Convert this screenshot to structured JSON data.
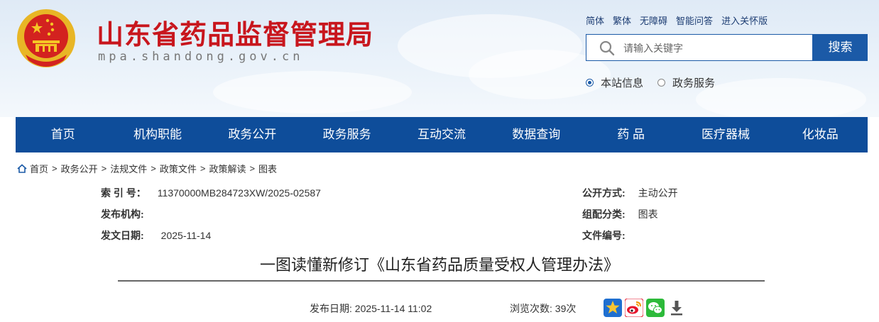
{
  "header": {
    "site_title": "山东省药品监督管理局",
    "site_domain": "mpa.shandong.gov.cn",
    "top_links": [
      "简体",
      "繁体",
      "无障碍",
      "智能问答",
      "进入关怀版"
    ],
    "search": {
      "placeholder": "请输入关键字",
      "button_label": "搜索"
    },
    "scope_options": [
      {
        "label": "本站信息",
        "selected": true
      },
      {
        "label": "政务服务",
        "selected": false
      }
    ]
  },
  "nav": [
    "首页",
    "机构职能",
    "政务公开",
    "政务服务",
    "互动交流",
    "数据查询",
    "药 品",
    "医疗器械",
    "化妆品"
  ],
  "breadcrumb": [
    "首页",
    "政务公开",
    "法规文件",
    "政策文件",
    "政策解读",
    "图表"
  ],
  "meta": {
    "index_label": "索 引 号：",
    "index_value": "11370000MB284723XW/2025-02587",
    "issuer_label": "发布机构:",
    "issuer_value": "",
    "date_label": "发文日期:",
    "date_value": "2025-11-14",
    "disclosure_label": "公开方式:",
    "disclosure_value": "主动公开",
    "category_label": "组配分类:",
    "category_value": "图表",
    "docno_label": "文件编号:",
    "docno_value": ""
  },
  "article": {
    "title": "一图读懂新修订《山东省药品质量受权人管理办法》",
    "publish_text": "发布日期:  2025-11-14 11:02",
    "views_text": "浏览次数:  39次"
  },
  "share_icons": [
    "favorite-star-icon",
    "weibo-icon",
    "wechat-icon",
    "download-icon"
  ],
  "colors": {
    "brand_red": "#c8161d",
    "nav_blue": "#0e4d9a",
    "button_blue": "#1b5aa7"
  }
}
